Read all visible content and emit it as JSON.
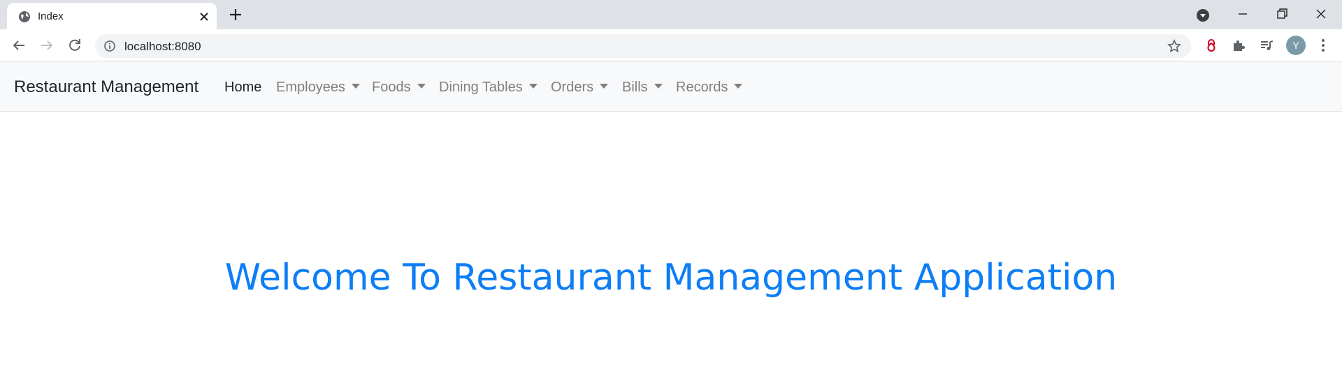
{
  "browser": {
    "tab": {
      "title": "Index",
      "favicon": "globe-icon"
    },
    "address_bar": {
      "url": "localhost:8080"
    },
    "profile_initial": "Y"
  },
  "navbar": {
    "brand": "Restaurant Management",
    "items": [
      {
        "label": "Home",
        "active": true,
        "dropdown": false
      },
      {
        "label": "Employees",
        "active": false,
        "dropdown": true
      },
      {
        "label": "Foods",
        "active": false,
        "dropdown": true
      },
      {
        "label": "Dining Tables",
        "active": false,
        "dropdown": true
      },
      {
        "label": "Orders",
        "active": false,
        "dropdown": true
      },
      {
        "label": "Bills",
        "active": false,
        "dropdown": true
      },
      {
        "label": "Records",
        "active": false,
        "dropdown": true
      }
    ]
  },
  "main": {
    "heading": "Welcome To Restaurant Management Application",
    "heading_color": "#0d7ef6"
  }
}
